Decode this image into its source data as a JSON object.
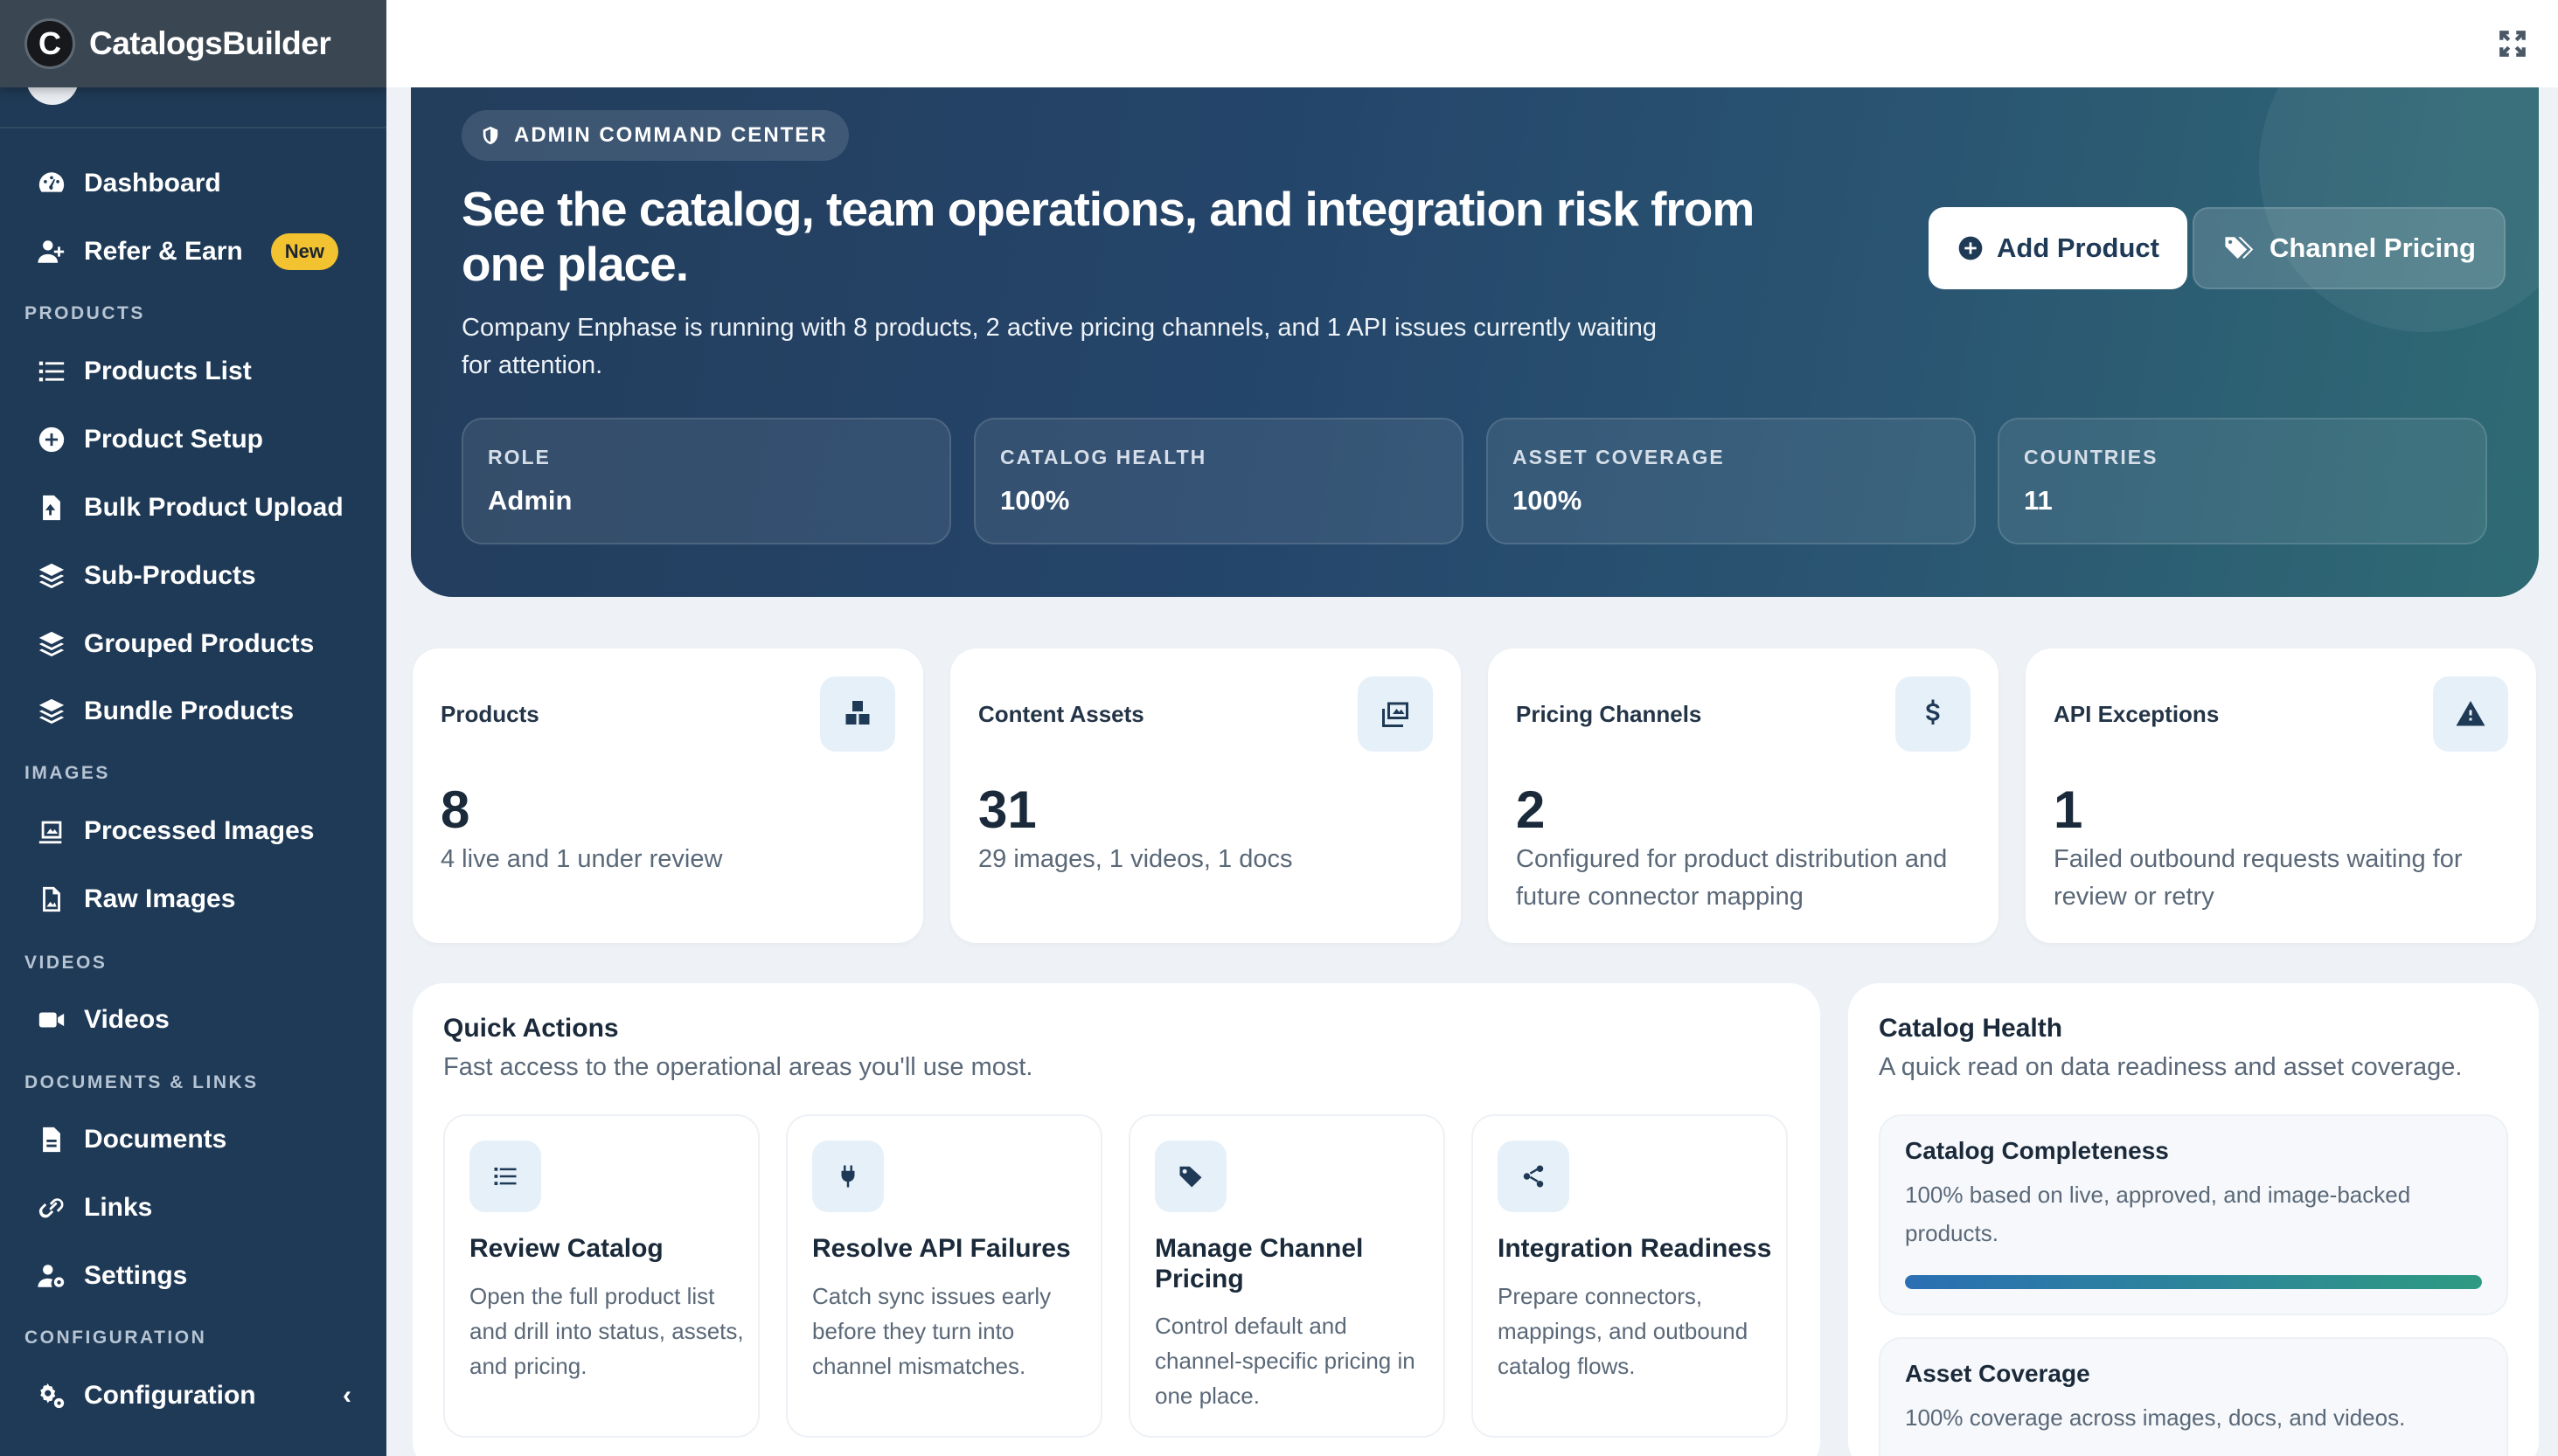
{
  "brand": {
    "initial": "C",
    "name": "CatalogsBuilder"
  },
  "sidebar": {
    "items": [
      {
        "label": "Dashboard"
      },
      {
        "label": "Refer & Earn",
        "badge": "New"
      },
      {
        "label": "Products List"
      },
      {
        "label": "Product Setup"
      },
      {
        "label": "Bulk Product Upload"
      },
      {
        "label": "Sub-Products"
      },
      {
        "label": "Grouped Products"
      },
      {
        "label": "Bundle Products"
      },
      {
        "label": "Processed Images"
      },
      {
        "label": "Raw Images"
      },
      {
        "label": "Videos"
      },
      {
        "label": "Documents"
      },
      {
        "label": "Links"
      },
      {
        "label": "Settings"
      },
      {
        "label": "Configuration"
      }
    ],
    "sections": {
      "products": "PRODUCTS",
      "images": "IMAGES",
      "videos": "VIDEOS",
      "documents": "DOCUMENTS & LINKS",
      "configuration": "CONFIGURATION"
    }
  },
  "hero": {
    "tag": "ADMIN COMMAND CENTER",
    "title": "See the catalog, team operations, and integration risk from one place.",
    "subtitle": "Company Enphase is running with 8 products, 2 active pricing channels, and 1 API issues currently waiting for attention.",
    "add_product_label": "Add Product",
    "channel_pricing_label": "Channel Pricing",
    "stats": [
      {
        "label": "ROLE",
        "value": "Admin"
      },
      {
        "label": "CATALOG HEALTH",
        "value": "100%"
      },
      {
        "label": "ASSET COVERAGE",
        "value": "100%"
      },
      {
        "label": "COUNTRIES",
        "value": "11"
      }
    ]
  },
  "kpis": [
    {
      "title": "Products",
      "value": "8",
      "desc": "4 live and 1 under review",
      "icon": "boxes-icon"
    },
    {
      "title": "Content Assets",
      "value": "31",
      "desc": "29 images, 1 videos, 1 docs",
      "icon": "photo-video-icon"
    },
    {
      "title": "Pricing Channels",
      "value": "2",
      "desc": "Configured for product distribution and future connector mapping",
      "icon": "dollar-icon"
    },
    {
      "title": "API Exceptions",
      "value": "1",
      "desc": "Failed outbound requests waiting for review or retry",
      "icon": "warning-icon"
    }
  ],
  "quick_actions": {
    "title": "Quick Actions",
    "subtitle": "Fast access to the operational areas you'll use most.",
    "cards": [
      {
        "title": "Review Catalog",
        "desc": "Open the full product list and drill into status, assets, and pricing.",
        "icon": "list-icon"
      },
      {
        "title": "Resolve API Failures",
        "desc": "Catch sync issues early before they turn into channel mismatches.",
        "icon": "plug-icon"
      },
      {
        "title": "Manage Channel Pricing",
        "desc": "Control default and channel-specific pricing in one place.",
        "icon": "tag-icon"
      },
      {
        "title": "Integration Readiness",
        "desc": "Prepare connectors, mappings, and outbound catalog flows.",
        "icon": "share-icon"
      }
    ]
  },
  "catalog_health": {
    "title": "Catalog Health",
    "subtitle": "A quick read on data readiness and asset coverage.",
    "completeness_title": "Catalog Completeness",
    "completeness_desc": "100% based on live, approved, and image-backed products.",
    "completeness_progress": 1.0,
    "asset_title": "Asset Coverage",
    "asset_desc": "100% coverage across images, docs, and videos."
  },
  "colors": {
    "sidebar_bg": "#1f3a56",
    "hero_start": "#233d5c",
    "hero_end": "#2f6b74",
    "badge": "#f2c230",
    "progress_start": "#2a6fb3",
    "progress_end": "#2f9a82"
  }
}
